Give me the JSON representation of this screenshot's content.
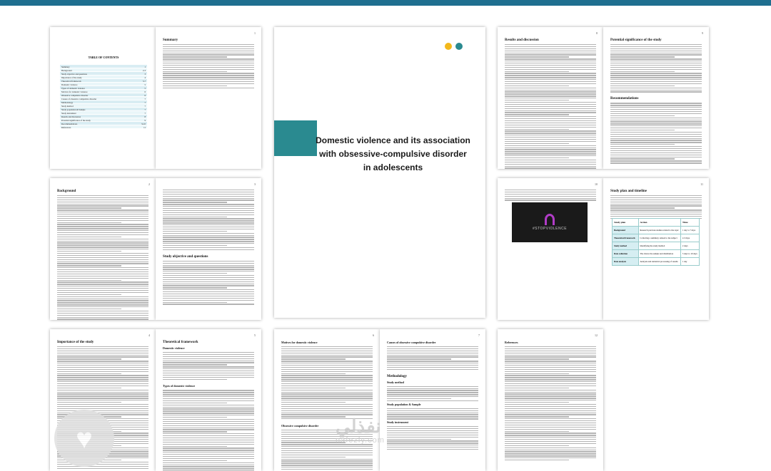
{
  "cover": {
    "title_line1": "Domestic violence and its association",
    "title_line2": "with obsessive-compulsive disorder",
    "title_line3": "in adolescents",
    "accent_color": "#2a8a90",
    "dot_colors": [
      "#f3b81b",
      "#2a8a90"
    ]
  },
  "toc": {
    "title": "TABLE OF CONTENTS",
    "rows": [
      {
        "label": "Summary",
        "page": "1"
      },
      {
        "label": "Background",
        "page": "2-3"
      },
      {
        "label": "Study objective and questions",
        "page": "3"
      },
      {
        "label": "Importance of the study",
        "page": "4"
      },
      {
        "label": "Theoretical framework",
        "page": "5-7"
      },
      {
        "label": "Domestic violence",
        "page": "5"
      },
      {
        "label": "Types of domestic violence",
        "page": "5"
      },
      {
        "label": "Motives for domestic violence",
        "page": "6"
      },
      {
        "label": "Obsessive compulsive disorder",
        "page": "6"
      },
      {
        "label": "Causes of obsessive compulsive disorder",
        "page": "7"
      },
      {
        "label": "Methodology",
        "page": "7"
      },
      {
        "label": "Study method",
        "page": "7"
      },
      {
        "label": "Study population & Sample",
        "page": "7"
      },
      {
        "label": "Study instrument",
        "page": "7"
      },
      {
        "label": "Results and discussion",
        "page": "8"
      },
      {
        "label": "Potential significance of the study",
        "page": "9"
      },
      {
        "label": "Recommendations",
        "page": "9-10"
      },
      {
        "label": "References",
        "page": "11"
      }
    ]
  },
  "pages": {
    "summary": {
      "heading": "Summary",
      "num": "1"
    },
    "background": {
      "heading": "Background",
      "num": "2"
    },
    "objectives": {
      "heading": "Study objective and questions",
      "num": "3"
    },
    "importance": {
      "heading": "Importance of the study",
      "num": "4"
    },
    "theory": {
      "heading": "Theoretical framework",
      "num": "5",
      "sub1": "Domestic violence",
      "sub2": "Types of domestic violence"
    },
    "motives": {
      "heading": "Motives for domestic violence",
      "num": "6",
      "sub1": "Obsessive compulsive disorder"
    },
    "causes": {
      "heading": "Causes of obsessive compulsive disorder",
      "num": "7",
      "sub1": "Methodology",
      "sub2": "Study method",
      "sub3": "Study population & Sample",
      "sub4": "Study instrument"
    },
    "results": {
      "heading": "Results and discussion",
      "num": "8"
    },
    "significance": {
      "heading": "Potential significance of the study",
      "num": "9",
      "sub1": "Recommendations"
    },
    "image_page": {
      "num": "10",
      "image_caption": "#STOPVIOLENCE"
    },
    "plan": {
      "heading": "Study plan and timeline",
      "num": "11"
    },
    "references": {
      "heading": "References",
      "num": "12"
    }
  },
  "plan_table": {
    "headers": [
      "Study plan",
      "Action",
      "Time"
    ],
    "rows": [
      {
        "k": "Background",
        "a": "Research previous studies related to the topic",
        "t": "1 day to 7 days"
      },
      {
        "k": "Theoretical framework",
        "a": "Collecting a summary related to the subject",
        "t": "2-3 days"
      },
      {
        "k": "Study method",
        "a": "Identifying the study method",
        "t": "2 days"
      },
      {
        "k": "Data collection",
        "a": "The choice the sample and distribution",
        "t": "5 days to 10 days"
      },
      {
        "k": "Data analysis",
        "a": "Analysis and statistical processing of results",
        "t": "1 day"
      }
    ]
  },
  "watermark": {
    "arabic": "نفذلي",
    "latin": "nafezly.com"
  }
}
